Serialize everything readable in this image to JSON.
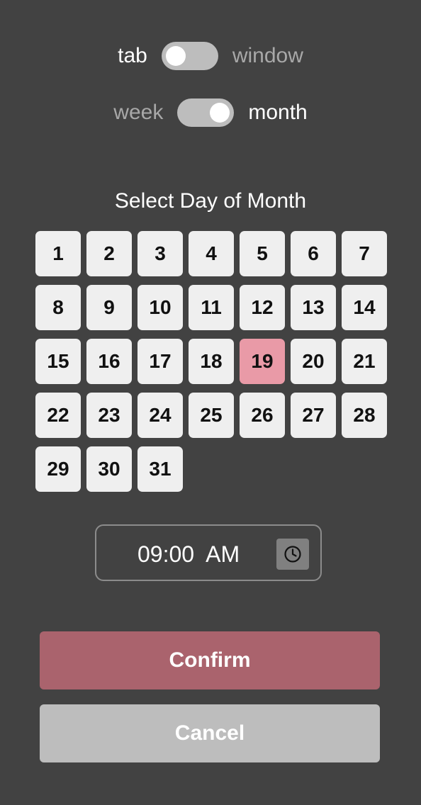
{
  "toggles": {
    "target": {
      "left_label": "tab",
      "right_label": "window",
      "selected": "tab"
    },
    "period": {
      "left_label": "week",
      "right_label": "month",
      "selected": "month"
    }
  },
  "section_title": "Select Day of Month",
  "days": [
    "1",
    "2",
    "3",
    "4",
    "5",
    "6",
    "7",
    "8",
    "9",
    "10",
    "11",
    "12",
    "13",
    "14",
    "15",
    "16",
    "17",
    "18",
    "19",
    "20",
    "21",
    "22",
    "23",
    "24",
    "25",
    "26",
    "27",
    "28",
    "29",
    "30",
    "31"
  ],
  "selected_day": "19",
  "time": {
    "value": "09:00  AM",
    "icon": "clock-icon"
  },
  "buttons": {
    "confirm": "Confirm",
    "cancel": "Cancel"
  },
  "colors": {
    "background": "#424242",
    "selected_day": "#e99aa7",
    "confirm": "#aa636d",
    "cancel": "#bdbdbd"
  }
}
